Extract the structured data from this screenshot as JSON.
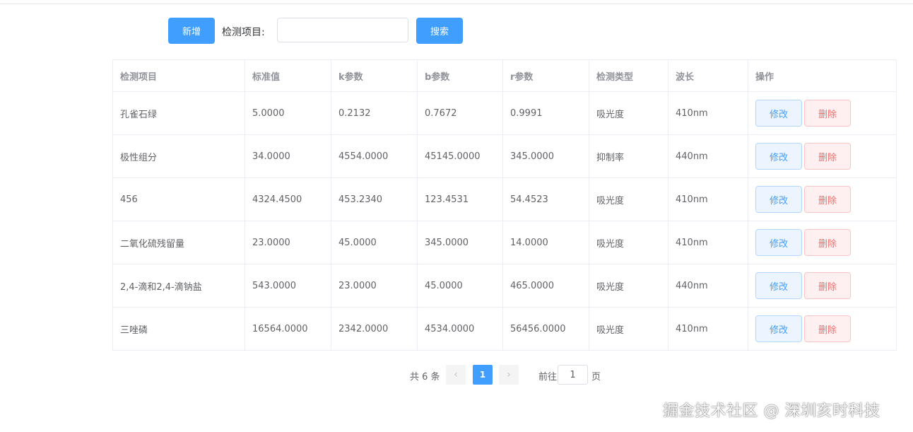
{
  "toolbar": {
    "add_label": "新增",
    "search_label": "检测项目:",
    "search_value": "",
    "search_placeholder": "",
    "search_button": "搜索"
  },
  "table": {
    "headers": [
      "检测项目",
      "标准值",
      "k参数",
      "b参数",
      "r参数",
      "检测类型",
      "波长",
      "操作"
    ],
    "rows": [
      {
        "name": "孔雀石绿",
        "std": "5.0000",
        "k": "0.2132",
        "b": "0.7672",
        "r": "0.9991",
        "type": "吸光度",
        "wave": "410nm",
        "edit": "修改",
        "del": "删除"
      },
      {
        "name": "极性组分",
        "std": "34.0000",
        "k": "4554.0000",
        "b": "45145.0000",
        "r": "345.0000",
        "type": "抑制率",
        "wave": "440nm",
        "edit": "修改",
        "del": "删除"
      },
      {
        "name": "456",
        "std": "4324.4500",
        "k": "453.2340",
        "b": "123.4531",
        "r": "54.4523",
        "type": "吸光度",
        "wave": "410nm",
        "edit": "修改",
        "del": "删除"
      },
      {
        "name": "二氧化硫残留量",
        "std": "23.0000",
        "k": "45.0000",
        "b": "345.0000",
        "r": "14.0000",
        "type": "吸光度",
        "wave": "410nm",
        "edit": "修改",
        "del": "删除"
      },
      {
        "name": "2,4-滴和2,4-滴钠盐",
        "std": "543.0000",
        "k": "23.0000",
        "b": "45.0000",
        "r": "465.0000",
        "type": "吸光度",
        "wave": "440nm",
        "edit": "修改",
        "del": "删除"
      },
      {
        "name": "三唑磷",
        "std": "16564.0000",
        "k": "2342.0000",
        "b": "4534.0000",
        "r": "56456.0000",
        "type": "吸光度",
        "wave": "410nm",
        "edit": "修改",
        "del": "删除"
      }
    ]
  },
  "pagination": {
    "total_text": "共 6 条",
    "current_page": "1",
    "goto_label": "前往",
    "goto_value": "1",
    "goto_suffix": "页",
    "prev_icon": "chevron-left-icon",
    "next_icon": "chevron-right-icon"
  },
  "watermark": "掘金技术社区 @ 深圳亥时科技",
  "colors": {
    "primary": "#409eff",
    "danger": "#f56c6c",
    "border": "#ebeef5",
    "header_text": "#909399",
    "body_text": "#606266"
  }
}
